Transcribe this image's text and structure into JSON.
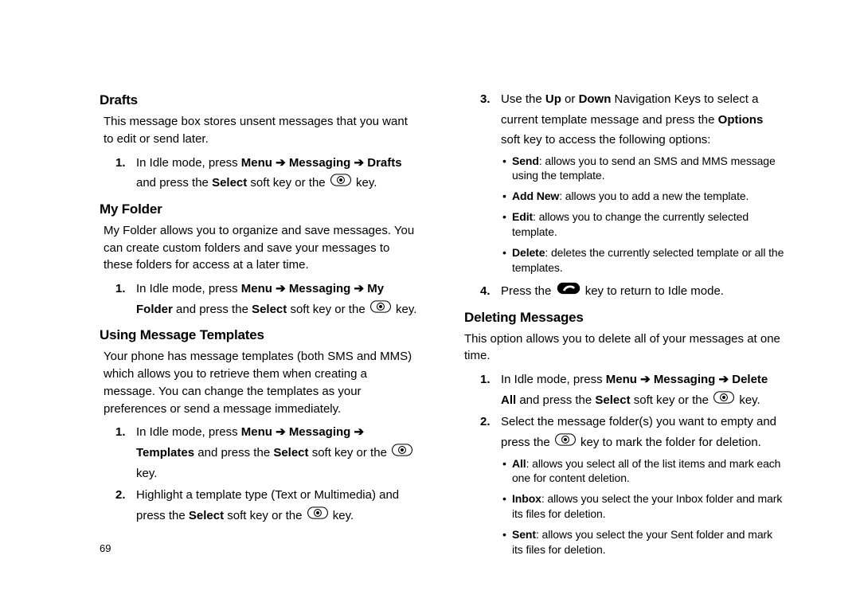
{
  "page_number": "69",
  "left": {
    "drafts": {
      "heading": "Drafts",
      "intro": "This message box stores unsent messages that you want to edit or send later.",
      "step1_pre": "In Idle mode, press ",
      "step1_menu": "Menu",
      "step1_arrow1": " ➔ ",
      "step1_messaging": "Messaging",
      "step1_arrow2": " ➔ ",
      "step1_drafts": "Drafts",
      "step1_and": " and press the ",
      "step1_select": "Select",
      "step1_post": " soft key or the ",
      "step1_end": " key."
    },
    "myfolder": {
      "heading": "My Folder",
      "intro": "My Folder allows you to organize and save messages. You can create custom folders and save your messages to these folders for access at a later time.",
      "s1_pre": "In Idle mode, press ",
      "s1_menu": "Menu",
      "s1_a1": " ➔ ",
      "s1_msg": "Messaging",
      "s1_a2": " ➔ ",
      "s1_mf": "My Folder",
      "s1_and": " and press the ",
      "s1_select": "Select",
      "s1_post": " soft key or the ",
      "s1_end": " key."
    },
    "templates": {
      "heading": "Using Message Templates",
      "intro": "Your phone has message templates (both SMS and MMS) which allows you to retrieve them when creating a message. You can change the templates as your preferences or send a message immediately.",
      "s1_pre": "In Idle mode, press ",
      "s1_menu": "Menu",
      "s1_a1": " ➔ ",
      "s1_msg": "Messaging",
      "s1_a2": " ➔ ",
      "s1_tpl": "Templates",
      "s1_and": " and press the ",
      "s1_select": "Select",
      "s1_post": " soft key or the ",
      "s1_end": " key.",
      "s2_pre": "Highlight a template type (Text or Multimedia) and press the ",
      "s2_select": "Select",
      "s2_post": " soft key or the ",
      "s2_end": " key."
    }
  },
  "right": {
    "cont": {
      "s3_pre": "Use the ",
      "s3_up": "Up",
      "s3_or": " or ",
      "s3_down": "Down",
      "s3_mid1": " Navigation Keys to select a current template message and press the ",
      "s3_options": "Options",
      "s3_mid2": " soft key to access the following options:",
      "b1_name": "Send",
      "b1_text": ": allows you to send an SMS and MMS message using the template.",
      "b2_name": "Add New",
      "b2_text": ": allows you to add a new the template.",
      "b3_name": "Edit",
      "b3_text": ": allows you to change the currently selected template.",
      "b4_name": "Delete",
      "b4_text": ": deletes the currently selected template or all the templates.",
      "s4_pre": "Press the ",
      "s4_post": " key to return to Idle mode."
    },
    "deleting": {
      "heading": "Deleting Messages",
      "intro": "This option allows you to delete all of your messages at one time.",
      "s1_pre": "In Idle mode, press ",
      "s1_menu": "Menu",
      "s1_a1": " ➔ ",
      "s1_msg": "Messaging",
      "s1_a2": " ➔ ",
      "s1_del": "Delete All",
      "s1_and": " and press the ",
      "s1_select": "Select",
      "s1_post": " soft key or the ",
      "s1_end": " key.",
      "s2_pre": "Select the message folder(s) you want to empty and press the ",
      "s2_post": " key to mark the folder for deletion.",
      "b1_name": "All",
      "b1_text": ": allows you select all of the list items and mark each one for content deletion.",
      "b2_name": "Inbox",
      "b2_text": ": allows you select the your Inbox folder and mark its files for deletion.",
      "b3_name": "Sent",
      "b3_text": ": allows you select the your Sent folder and mark its files for deletion."
    }
  },
  "icons": {
    "ok_key": "ok-key-icon",
    "end_key": "end-key-icon"
  }
}
